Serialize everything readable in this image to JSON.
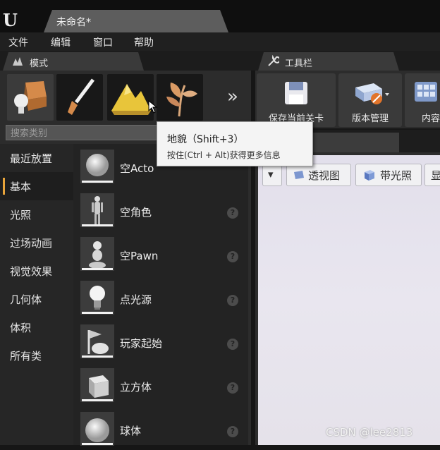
{
  "app": {
    "logo_text": "U",
    "document_tab": "未命名*"
  },
  "menu": [
    "文件",
    "编辑",
    "窗口",
    "帮助"
  ],
  "panels": {
    "modes_tab": "模式",
    "toolbar_tab": "工具栏"
  },
  "modes": {
    "buttons": [
      {
        "name": "place-mode",
        "icon": "cube-and-sphere-icon"
      },
      {
        "name": "paint-mode",
        "icon": "paintbrush-icon"
      },
      {
        "name": "landscape-mode",
        "icon": "mountain-icon"
      },
      {
        "name": "foliage-mode",
        "icon": "leaf-icon"
      }
    ],
    "more_label": "»",
    "search_placeholder": "搜索类别",
    "categories": [
      "最近放置",
      "基本",
      "光照",
      "过场动画",
      "视觉效果",
      "几何体",
      "体积",
      "所有类"
    ],
    "selected_category": "基本",
    "items": [
      {
        "label": "空Actor",
        "visible_label": "空Acto",
        "icon": "sphere-icon"
      },
      {
        "label": "空角色",
        "icon": "mannequin-icon"
      },
      {
        "label": "空Pawn",
        "icon": "pawn-icon"
      },
      {
        "label": "点光源",
        "icon": "lightbulb-icon"
      },
      {
        "label": "玩家起始",
        "icon": "player-start-icon"
      },
      {
        "label": "立方体",
        "icon": "cube-icon"
      },
      {
        "label": "球体",
        "icon": "sphere-icon"
      }
    ],
    "help_glyph": "?"
  },
  "toolbar": {
    "buttons": [
      {
        "label": "保存当前关卡",
        "icon": "floppy-disk-icon"
      },
      {
        "label": "版本管理",
        "icon": "source-control-icon"
      },
      {
        "label": "内容",
        "icon": "content-grid-icon"
      }
    ]
  },
  "viewport": {
    "buttons": [
      {
        "label": "透视图",
        "icon": "perspective-icon"
      },
      {
        "label": "带光照",
        "icon": "lit-cube-icon"
      },
      {
        "label": "显",
        "icon": ""
      }
    ],
    "dropdown_glyph": "▾"
  },
  "tooltip": {
    "title": "地貌（Shift+3）",
    "hint": "按住(Ctrl + Alt)获得更多信息"
  },
  "watermark": "CSDN @lee2813",
  "colors": {
    "accent": "#e8a43a",
    "panel": "#2c2c2c",
    "viewport_bg": "#e6e3ec"
  }
}
